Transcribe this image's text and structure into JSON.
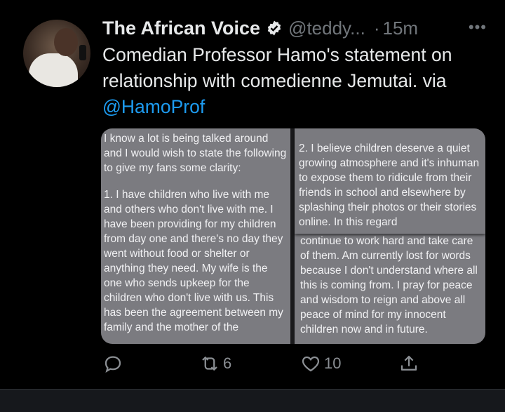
{
  "tweet": {
    "display_name": "The African Voice",
    "handle": "@teddy...",
    "separator": "·",
    "time": "15m",
    "more_label": "•••",
    "text_prefix": "Comedian Professor Hamo's statement on relationship with comedienne Jemutai. via ",
    "mention": "@HamoProf"
  },
  "media": {
    "left_paragraph_1": "I know a lot is being talked around and I would wish to state the following to give my fans some clarity:",
    "left_paragraph_2": "1. I have children who live with me and others who don't live with me. I have been providing for my children from day one and there's no day they went without food or shelter or anything they need. My wife is the one who sends upkeep for the children who don't live with us. This has been the agreement between my family and the mother of the",
    "right_top": "2. I believe children deserve a quiet growing atmosphere and it's inhuman to expose them to ridicule from their friends in school and elsewhere by splashing their photos or their stories online. In this regard",
    "right_bottom_cut": "continue to work hard and take care",
    "right_bottom": "of them. Am currently lost for words because I don't understand where all this is coming from. I pray for peace and wisdom to reign and above all peace of mind for my innocent children now and in future."
  },
  "actions": {
    "reply_count": "",
    "retweet_count": "6",
    "like_count": "10"
  },
  "colors": {
    "background": "#000000",
    "text": "#e7e9ea",
    "secondary": "#71767b",
    "accent": "#1d9bf0"
  }
}
